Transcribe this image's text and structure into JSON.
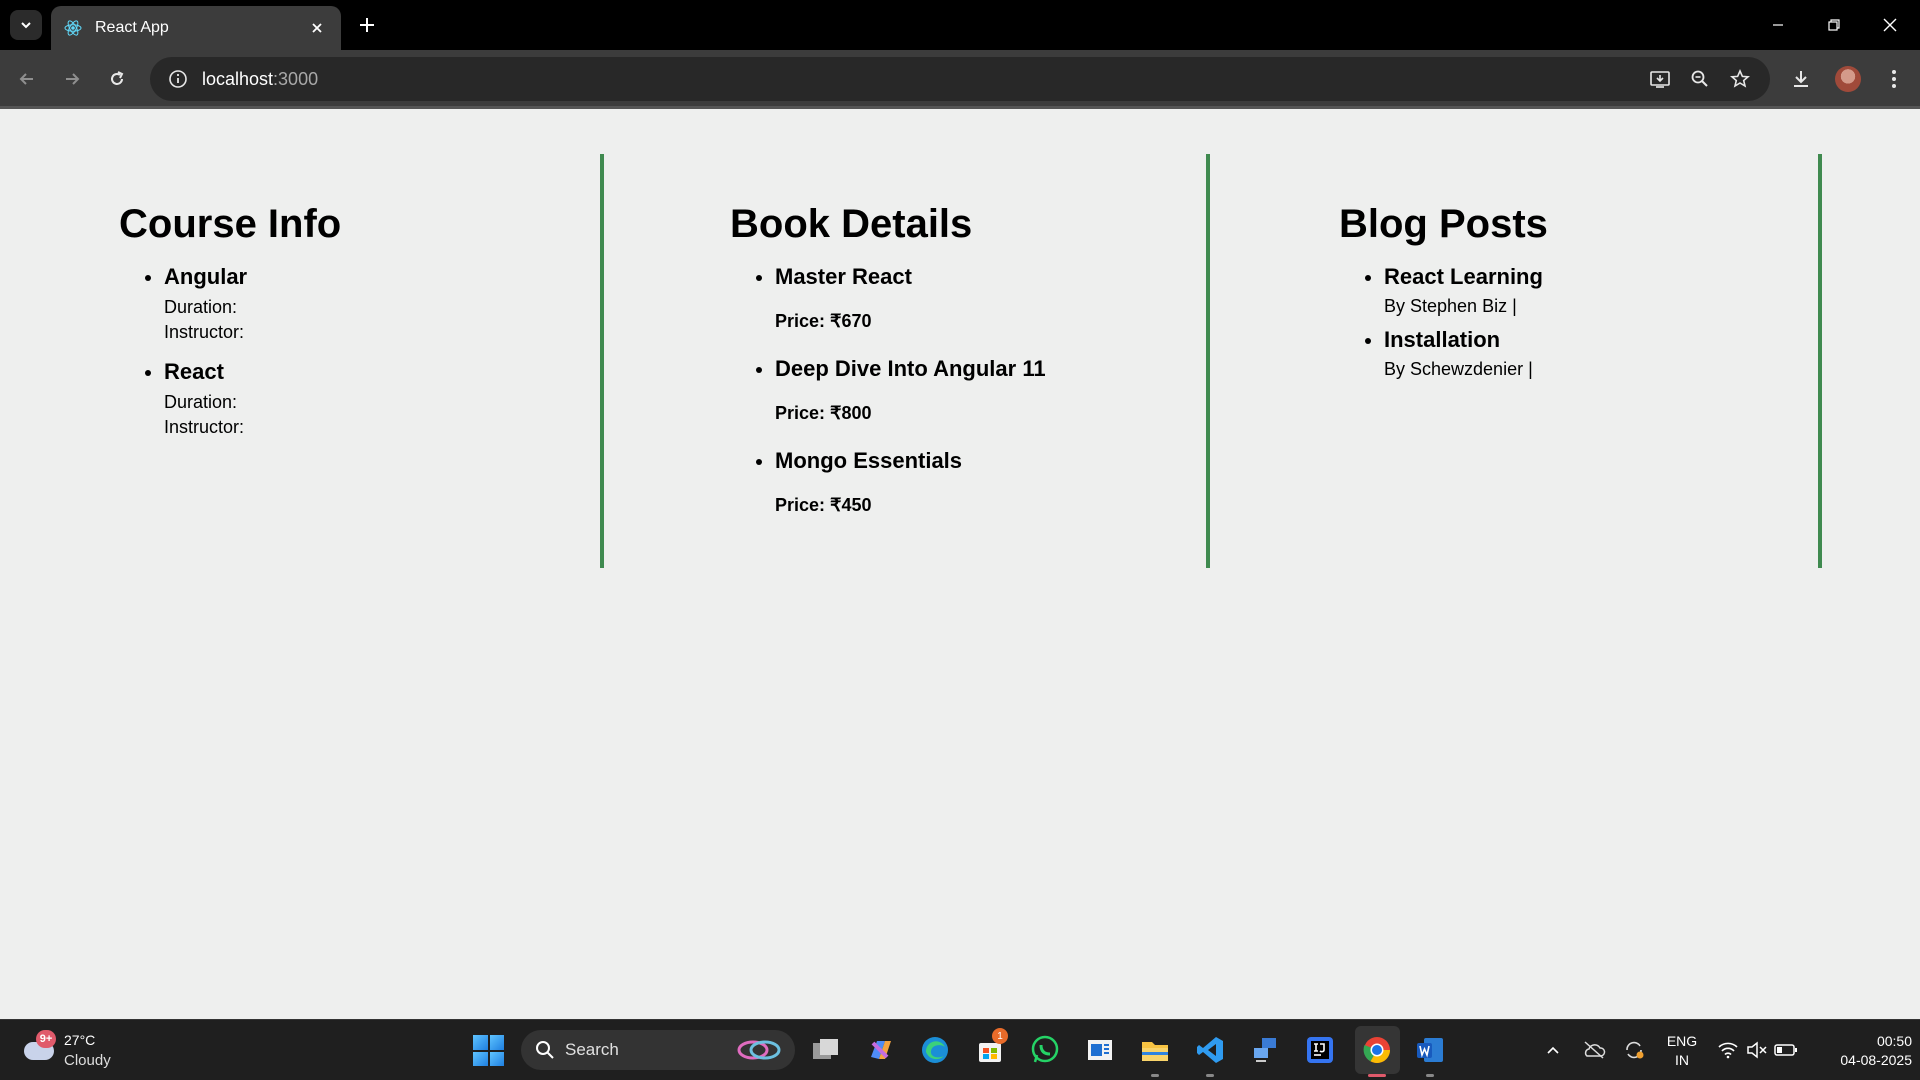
{
  "browser": {
    "tab_title": "React App",
    "url_host": "localhost",
    "url_port": ":3000"
  },
  "course_info": {
    "heading": "Course Info",
    "items": [
      {
        "title": "Angular",
        "duration_label": "Duration:",
        "instructor_label": "Instructor:"
      },
      {
        "title": "React",
        "duration_label": "Duration:",
        "instructor_label": "Instructor:"
      }
    ]
  },
  "book_details": {
    "heading": "Book Details",
    "items": [
      {
        "title": "Master React",
        "price": "Price: ₹670"
      },
      {
        "title": "Deep Dive Into Angular 11",
        "price": "Price: ₹800"
      },
      {
        "title": "Mongo Essentials",
        "price": "Price: ₹450"
      }
    ]
  },
  "blog_posts": {
    "heading": "Blog Posts",
    "items": [
      {
        "title": "React Learning",
        "byline": "By Stephen Biz |"
      },
      {
        "title": "Installation",
        "byline": "By Schewzdenier |"
      }
    ]
  },
  "taskbar": {
    "weather_temp": "27°C",
    "weather_condition": "Cloudy",
    "weather_badge": "9+",
    "search_label": "Search",
    "store_badge": "1",
    "language_line1": "ENG",
    "language_line2": "IN",
    "time": "00:50",
    "date": "04-08-2025"
  },
  "colors": {
    "page_background": "#eeefee",
    "divider_green": "#3f8a4f",
    "chrome_dark": "#3c3c3c"
  }
}
